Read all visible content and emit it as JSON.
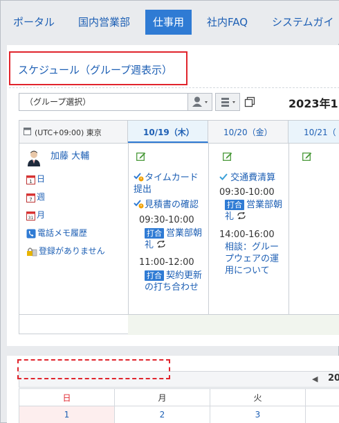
{
  "nav": {
    "tabs": [
      {
        "label": "ポータル"
      },
      {
        "label": "国内営業部"
      },
      {
        "label": "仕事用"
      },
      {
        "label": "社内FAQ"
      },
      {
        "label": "システムガイ"
      }
    ],
    "active_tab": "仕事用"
  },
  "schedule": {
    "title": "スケジュール（グループ週表示）",
    "group_select": "（グループ選択）",
    "year_label": "2023年1",
    "timezone": "(UTC+09:00) 東京",
    "days": [
      {
        "label": "10/19（木）"
      },
      {
        "label": "10/20（金）"
      },
      {
        "label": "10/21（"
      }
    ],
    "user": {
      "name": "加藤 大輔",
      "links": [
        "日",
        "週",
        "月",
        "電話メモ履歴",
        "登録がありません"
      ]
    },
    "col1": {
      "todo1": "タイムカード提出",
      "todo2": "見積書の確認",
      "ev1_time": "09:30-10:00",
      "ev1_tag": "打合",
      "ev1_title": "営業部朝礼",
      "ev2_time": "11:00-12:00",
      "ev2_tag": "打合",
      "ev2_title": "契約更新の打ち合わせ"
    },
    "col2": {
      "todo1": "交通費清算",
      "ev1_time": "09:30-10:00",
      "ev1_tag": "打合",
      "ev1_title": "営業部朝礼",
      "ev2_time": "14:00-16:00",
      "ev2_title": "相談：グループウェアの運用について"
    }
  },
  "calendar": {
    "year_label": "20",
    "weekdays": [
      "日",
      "月",
      "火"
    ],
    "dates": [
      "1",
      "2",
      "3"
    ]
  },
  "colors": {
    "accent": "#2f7bd4",
    "link": "#1d5fb4",
    "highlight": "#e0242c"
  }
}
